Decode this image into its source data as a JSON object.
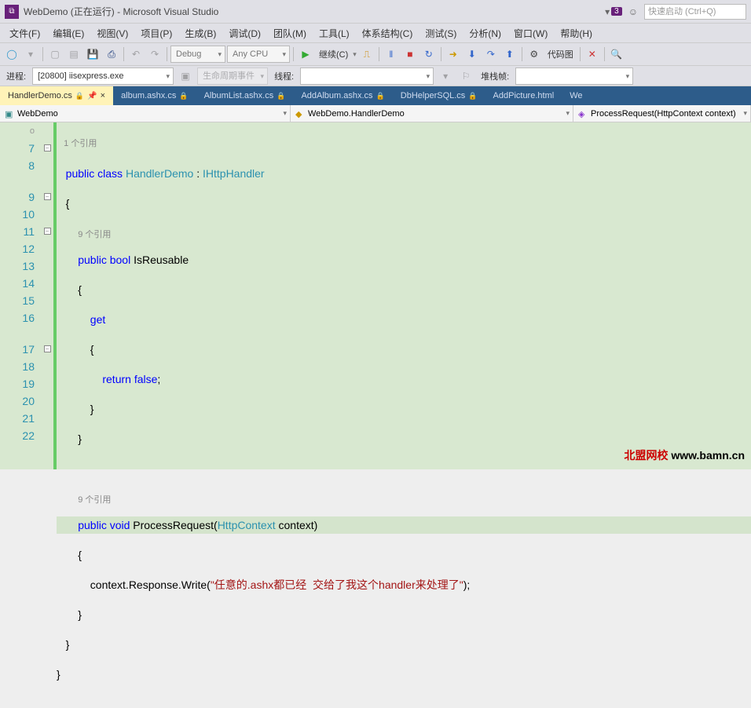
{
  "title": "WebDemo (正在运行) - Microsoft Visual Studio",
  "notifications": "3",
  "quicklaunch_placeholder": "快速启动 (Ctrl+Q)",
  "menu": [
    "文件(F)",
    "编辑(E)",
    "视图(V)",
    "项目(P)",
    "生成(B)",
    "调试(D)",
    "团队(M)",
    "工具(L)",
    "体系结构(C)",
    "测试(S)",
    "分析(N)",
    "窗口(W)",
    "帮助(H)"
  ],
  "toolbar": {
    "config": "Debug",
    "platform": "Any CPU",
    "continue": "继续(C)",
    "codemap": "代码图"
  },
  "toolbar2": {
    "process_label": "进程:",
    "process_value": "[20800] iisexpress.exe",
    "lifecycle": "生命周期事件",
    "thread_label": "线程:",
    "stackframe": "堆栈帧:"
  },
  "tabs": [
    {
      "label": "HandlerDemo.cs",
      "active": true,
      "pinned": true
    },
    {
      "label": "album.ashx.cs",
      "locked": true
    },
    {
      "label": "AlbumList.ashx.cs",
      "locked": true
    },
    {
      "label": "AddAlbum.ashx.cs",
      "locked": true
    },
    {
      "label": "DbHelperSQL.cs",
      "locked": true
    },
    {
      "label": "AddPicture.html"
    },
    {
      "label": "We"
    }
  ],
  "nav": {
    "project": "WebDemo",
    "class": "WebDemo.HandlerDemo",
    "member": "ProcessRequest(HttpContext context)"
  },
  "code": {
    "ref9a": "9 个引用",
    "ref9b": "9 个引用",
    "line6": "1 个引用",
    "public": "public",
    "class": "class",
    "bool": "bool",
    "void": "void",
    "get": "get",
    "return": "return",
    "false": "false",
    "HandlerDemo": "HandlerDemo",
    "IHttpHandler": "IHttpHandler",
    "IsReusable": "IsReusable",
    "ProcessRequest": "ProcessRequest",
    "HttpContext": "HttpContext",
    "context": "context",
    "writeCall": "context.Response.Write(",
    "stringLit": "\"任意的.ashx都已经  交给了我这个handler来处理了\"",
    "writeEnd": ");"
  },
  "watermark": {
    "red": "北盟网校",
    "url": "www.bamn.cn"
  }
}
